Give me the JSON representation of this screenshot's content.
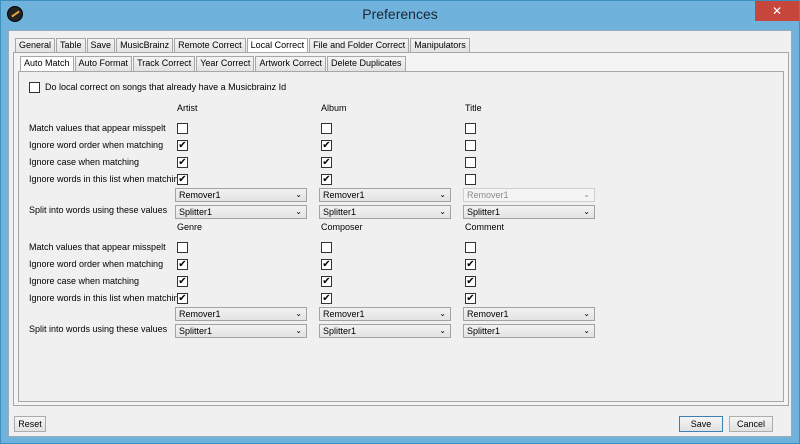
{
  "window": {
    "title": "Preferences",
    "close_glyph": "✕",
    "icon": "app-record-icon"
  },
  "main_tabs": [
    "General",
    "Table",
    "Save",
    "MusicBrainz",
    "Remote Correct",
    "Local Correct",
    "File and Folder Correct",
    "Manipulators"
  ],
  "main_active": 5,
  "sub_tabs": [
    "Auto Match",
    "Auto Format",
    "Track Correct",
    "Year Correct",
    "Artwork Correct",
    "Delete Duplicates"
  ],
  "sub_active": 0,
  "top_option": {
    "label": "Do local correct on songs that already have a Musicbrainz Id",
    "checked": false
  },
  "row_labels": {
    "misspelt": "Match values that appear misspelt",
    "word_order": "Ignore word order when matching",
    "case": "Ignore case when matching",
    "list": "Ignore words in this list when matching",
    "split": "Split into words using these values"
  },
  "sections": [
    {
      "columns": [
        {
          "header": "Artist",
          "misspelt": false,
          "word_order": true,
          "case": true,
          "list": true,
          "remover": "Remover1",
          "remover_disabled": false,
          "splitter": "Splitter1"
        },
        {
          "header": "Album",
          "misspelt": false,
          "word_order": true,
          "case": true,
          "list": true,
          "remover": "Remover1",
          "remover_disabled": false,
          "splitter": "Splitter1"
        },
        {
          "header": "Title",
          "misspelt": false,
          "word_order": false,
          "case": false,
          "list": false,
          "remover": "Remover1",
          "remover_disabled": true,
          "splitter": "Splitter1"
        }
      ]
    },
    {
      "columns": [
        {
          "header": "Genre",
          "misspelt": false,
          "word_order": true,
          "case": true,
          "list": true,
          "remover": "Remover1",
          "remover_disabled": false,
          "splitter": "Splitter1"
        },
        {
          "header": "Composer",
          "misspelt": false,
          "word_order": true,
          "case": true,
          "list": true,
          "remover": "Remover1",
          "remover_disabled": false,
          "splitter": "Splitter1"
        },
        {
          "header": "Comment",
          "misspelt": false,
          "word_order": true,
          "case": true,
          "list": true,
          "remover": "Remover1",
          "remover_disabled": false,
          "splitter": "Splitter1"
        }
      ]
    }
  ],
  "glyphs": {
    "check": "✔",
    "dropdown": "⌄"
  },
  "buttons": {
    "reset": "Reset",
    "save": "Save",
    "cancel": "Cancel"
  }
}
